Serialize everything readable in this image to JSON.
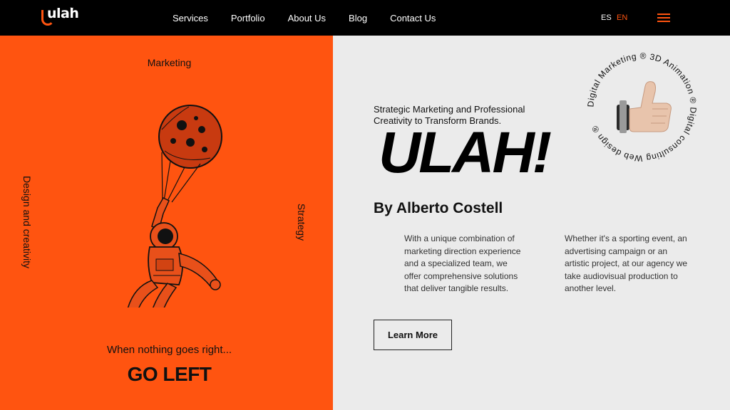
{
  "nav": {
    "logo": "ulah",
    "logo_tm": "™",
    "links": [
      "Services",
      "Portfolio",
      "About Us",
      "Blog",
      "Contact Us"
    ],
    "lang_es": "ES",
    "lang_en": "EN",
    "menu_icon": "hamburger-icon"
  },
  "left": {
    "label_top": "Marketing",
    "label_left": "Design and creativity",
    "label_right": "Strategy",
    "tagline": "When nothing goes right...",
    "headline": "GO LEFT",
    "illustration": "astronaut-holding-moon-balloon"
  },
  "right": {
    "subhead": "Strategic Marketing and Professional Creativity to Transform Brands.",
    "title": "ULAH!",
    "author": "By Alberto Costell",
    "para1": "With a unique combination of marketing direction experience and a specialized team, we offer comprehensive solutions that deliver tangible results.",
    "para2": "Whether it's a sporting event, an advertising campaign or an artistic project, at our agency we take audiovisual production to another level.",
    "cta": "Learn More",
    "badge_text": "Digital Marketing ® 3D Animation ® Digital consulting Web design ® ",
    "badge_icon": "thumbs-up-icon"
  },
  "colors": {
    "accent": "#ff5410",
    "nav_bg": "#000000",
    "right_bg": "#ebebeb"
  }
}
